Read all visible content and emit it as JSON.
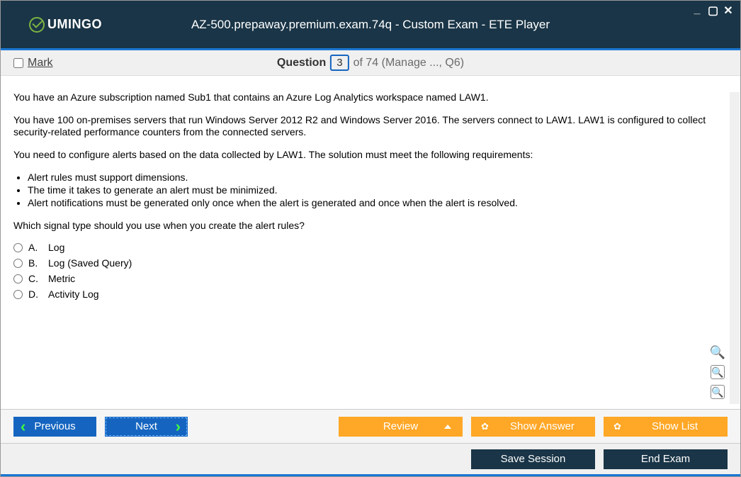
{
  "window": {
    "title": "AZ-500.prepaway.premium.exam.74q - Custom Exam - ETE Player",
    "logo": "UMINGO"
  },
  "questionBar": {
    "mark": "Mark",
    "label": "Question",
    "current": "3",
    "total": "of 74 (Manage ..., Q6)"
  },
  "content": {
    "p1": "You have an Azure subscription named Sub1 that contains an Azure Log Analytics workspace named LAW1.",
    "p2": "You have 100 on-premises servers that run Windows Server 2012 R2 and Windows Server 2016. The servers connect to LAW1. LAW1 is configured to collect security-related performance counters from the connected servers.",
    "p3": "You need to configure alerts based on the data collected by LAW1. The solution must meet the following requirements:",
    "bullets": [
      "Alert rules must support dimensions.",
      "The time it takes to generate an alert must be minimized.",
      "Alert notifications must be generated only once when the alert is generated and once when the alert is resolved."
    ],
    "p4": "Which signal type should you use when you create the alert rules?",
    "answers": [
      {
        "letter": "A.",
        "text": "Log"
      },
      {
        "letter": "B.",
        "text": "Log (Saved Query)"
      },
      {
        "letter": "C.",
        "text": "Metric"
      },
      {
        "letter": "D.",
        "text": "Activity Log"
      }
    ]
  },
  "buttons": {
    "previous": "Previous",
    "next": "Next",
    "review": "Review",
    "showAnswer": "Show Answer",
    "showList": "Show List",
    "saveSession": "Save Session",
    "endExam": "End Exam"
  }
}
